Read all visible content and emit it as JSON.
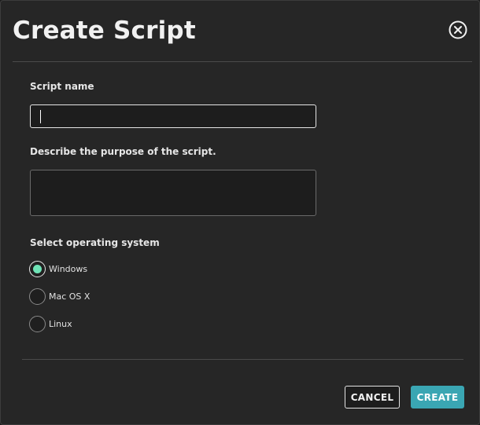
{
  "dialog": {
    "title": "Create Script",
    "close_icon": "close-circle-icon"
  },
  "form": {
    "name_label": "Script name",
    "name_value": "",
    "description_label": "Describe the purpose of the script.",
    "description_value": "",
    "os_label": "Select operating system",
    "os_options": [
      {
        "label": "Windows",
        "selected": true
      },
      {
        "label": "Mac OS X",
        "selected": false
      },
      {
        "label": "Linux",
        "selected": false
      }
    ]
  },
  "footer": {
    "cancel_label": "CANCEL",
    "create_label": "CREATE"
  },
  "colors": {
    "accent": "#3aa6b3",
    "radio_selected": "#6fe3b6",
    "background": "#262626"
  }
}
